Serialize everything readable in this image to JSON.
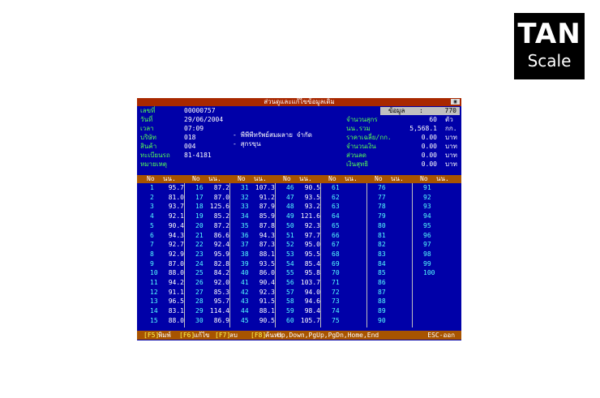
{
  "logo": {
    "line1": "TAN",
    "line2": "Scale"
  },
  "window": {
    "title": "ส่วนดูและแก้ไขข้อมูลเดิม",
    "close_label": "▣"
  },
  "info": {
    "labels": [
      "เลขที่",
      "วันที่",
      "เวลา",
      "บริษัท",
      "สินค้า",
      "ทะเบียนรถ",
      "หมายเหตุ"
    ],
    "values": [
      "00000757",
      "29/06/2004",
      "07:09",
      "018",
      "004",
      "81-4181",
      ""
    ],
    "company_name": "- พีพีพีทรัพย์สมผลาย จำกัด",
    "product_name": "- สุกรขุน"
  },
  "data_box": {
    "label": "ข้อมูล",
    "sep": ":",
    "value": "770"
  },
  "summary": {
    "labels": [
      "จำนวนสุกร",
      "นน.รวม",
      "ราคาเฉลี่ย/กก.",
      "จำนวนเงิน",
      "ส่วนลด",
      "เงินสุทธิ"
    ],
    "values": [
      "60",
      "5,568.1",
      "0.00",
      "0.00",
      "0.00",
      "0.00"
    ],
    "units": [
      "ตัว",
      "กก.",
      "บาท",
      "บาท",
      "บาท",
      "บาท"
    ]
  },
  "table": {
    "col_no": "No",
    "col_weight": "นน.",
    "columns": [
      {
        "nos": [
          "1",
          "2",
          "3",
          "4",
          "5",
          "6",
          "7",
          "8",
          "9",
          "10",
          "11",
          "12",
          "13",
          "14",
          "15"
        ],
        "weights": [
          "95.7",
          "81.0",
          "93.7",
          "92.1",
          "90.4",
          "94.3",
          "92.7",
          "92.9",
          "87.0",
          "88.0",
          "94.2",
          "91.1",
          "96.5",
          "83.1",
          "88.0"
        ]
      },
      {
        "nos": [
          "16",
          "17",
          "18",
          "19",
          "20",
          "21",
          "22",
          "23",
          "24",
          "25",
          "26",
          "27",
          "28",
          "29",
          "30"
        ],
        "weights": [
          "87.2",
          "87.0",
          "125.6",
          "85.2",
          "87.2",
          "86.6",
          "92.4",
          "95.9",
          "82.8",
          "84.2",
          "92.0",
          "85.3",
          "95.7",
          "114.4",
          "86.9"
        ]
      },
      {
        "nos": [
          "31",
          "32",
          "33",
          "34",
          "35",
          "36",
          "37",
          "38",
          "39",
          "40",
          "41",
          "42",
          "43",
          "44",
          "45"
        ],
        "weights": [
          "107.3",
          "91.2",
          "87.9",
          "85.9",
          "87.8",
          "94.3",
          "87.3",
          "88.1",
          "93.5",
          "86.0",
          "90.4",
          "92.3",
          "91.5",
          "88.1",
          "90.5"
        ]
      },
      {
        "nos": [
          "46",
          "47",
          "48",
          "49",
          "50",
          "51",
          "52",
          "53",
          "54",
          "55",
          "56",
          "57",
          "58",
          "59",
          "60"
        ],
        "weights": [
          "90.5",
          "93.5",
          "93.2",
          "121.6",
          "92.3",
          "97.7",
          "95.0",
          "95.5",
          "85.4",
          "95.8",
          "103.7",
          "94.0",
          "94.6",
          "98.4",
          "105.7"
        ]
      },
      {
        "nos": [
          "61",
          "62",
          "63",
          "64",
          "65",
          "66",
          "67",
          "68",
          "69",
          "70",
          "71",
          "72",
          "73",
          "74",
          "75"
        ],
        "weights": []
      },
      {
        "nos": [
          "76",
          "77",
          "78",
          "79",
          "80",
          "81",
          "82",
          "83",
          "84",
          "85",
          "86",
          "87",
          "88",
          "89",
          "90"
        ],
        "weights": []
      },
      {
        "nos": [
          "91",
          "92",
          "93",
          "94",
          "95",
          "96",
          "97",
          "98",
          "99",
          "100"
        ],
        "weights": []
      }
    ]
  },
  "footer": {
    "keys": [
      {
        "key": "[F5]",
        "label": "พิมพ์"
      },
      {
        "key": "[F6]",
        "label": "แก้ไข"
      },
      {
        "key": "[F7]",
        "label": "ลบ"
      },
      {
        "key": "[F8]",
        "label": "ค้นหา"
      }
    ],
    "nav": "Up,Down,PgUp,PgDn,Home,End",
    "esc": "ESC-ออก"
  },
  "colors": {
    "screen_bg": "#0000a8",
    "title_bg": "#a82800",
    "header_bg": "#a85400",
    "label": "#55ff55",
    "value": "#ffffff",
    "number": "#55ffff"
  }
}
